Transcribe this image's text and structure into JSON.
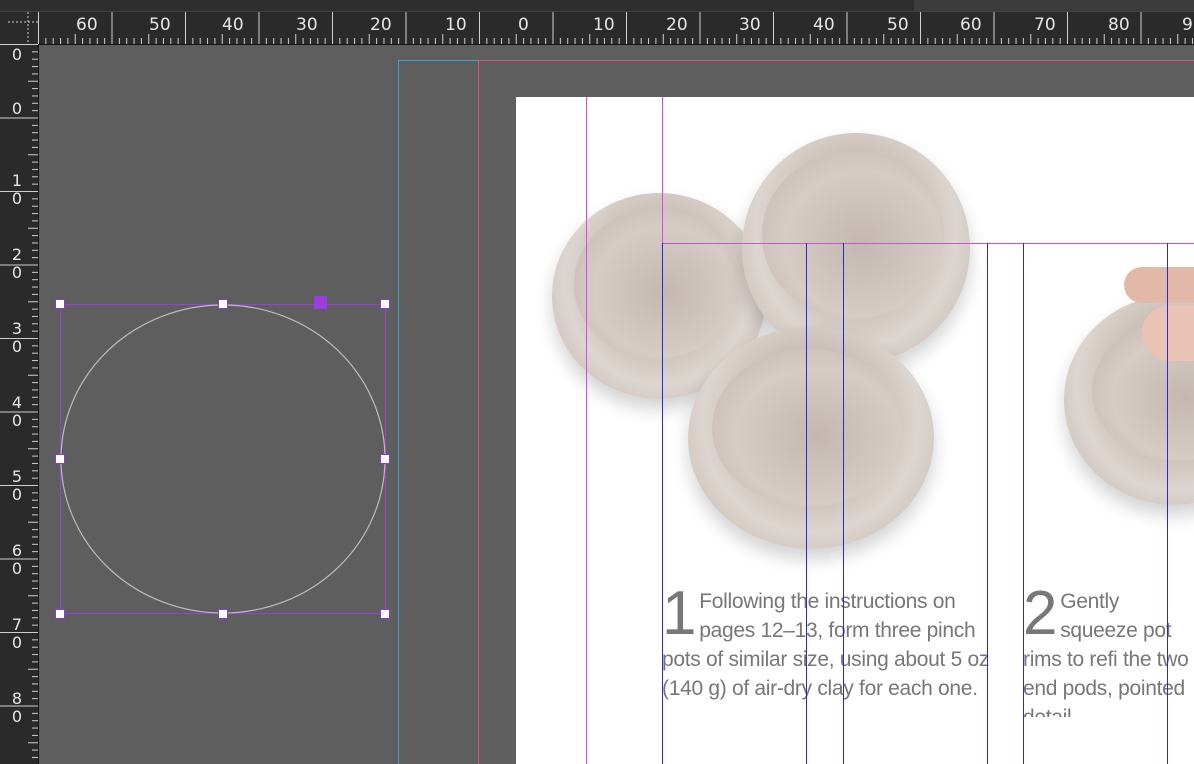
{
  "window": {
    "background": "#585858"
  },
  "horizontal_ruler": {
    "labels": [
      "60",
      "50",
      "40",
      "30",
      "20",
      "10",
      "0",
      "10",
      "20",
      "30",
      "40",
      "50",
      "60",
      "70",
      "80",
      "9"
    ]
  },
  "vertical_ruler": {
    "labels": [
      "0",
      "0",
      "10",
      "20",
      "30",
      "40",
      "50",
      "60",
      "70",
      "80"
    ]
  },
  "colors": {
    "pasteboard": "#5e5e5e",
    "bleed_guide": "#3fa0d8",
    "margin_guide": "#e0527a",
    "column_guide": "#2a2ad0",
    "ruler_guide": "#d34be0",
    "selection": "#9b3de0"
  },
  "page": {
    "photo1": {
      "subject": "three clay pinch pots"
    },
    "photo2": {
      "subject": "hand squeezing pot rim"
    },
    "step1": {
      "number": "1",
      "text": "Following the instructions on pages 12–13, form three pinch pots of similar size, using about 5 oz (140 g) of air-dry clay for each one."
    },
    "step2": {
      "number": "2",
      "text": "Gently squeeze pot rims to refi the two end pods, pointed detail."
    }
  },
  "selected_object": {
    "shape": "ellipse",
    "stroke": "#bdbdbd"
  },
  "icons": {
    "ruler_origin": "crosshair-icon"
  }
}
